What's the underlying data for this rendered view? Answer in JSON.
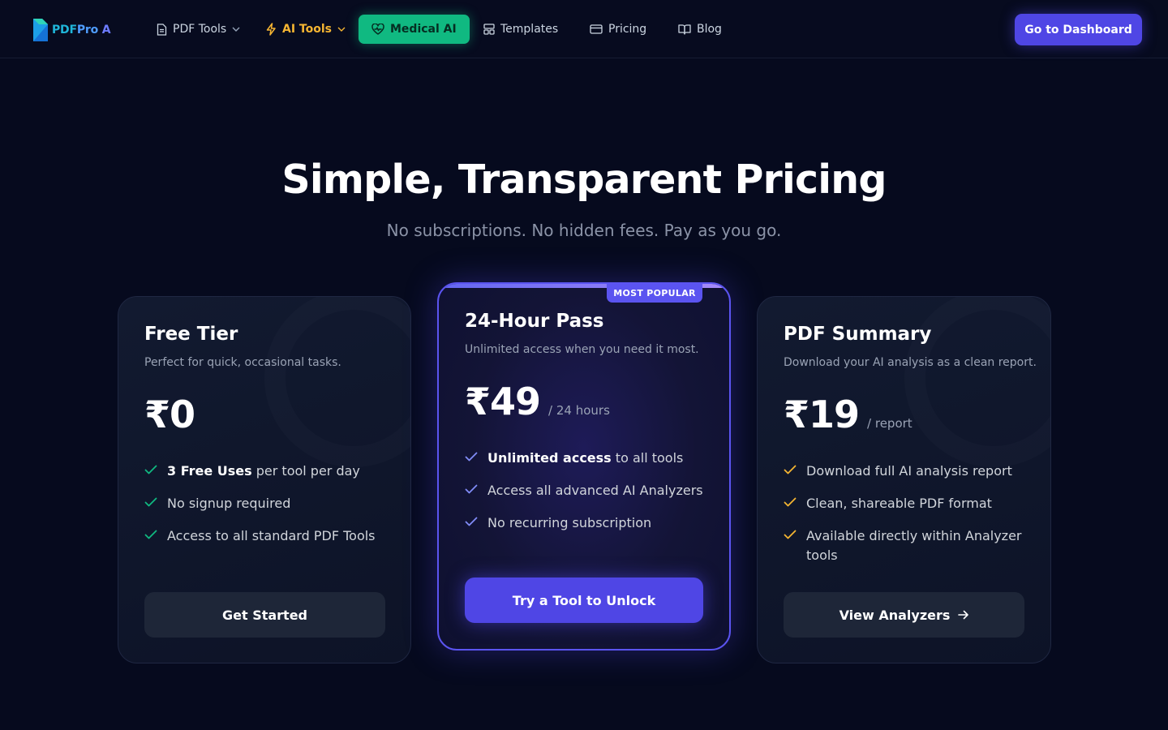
{
  "nav": {
    "logo": {
      "part1": "PDF",
      "part2": "Pro",
      "part3": " A"
    },
    "items": [
      {
        "label": "PDF Tools"
      },
      {
        "label": "AI Tools"
      },
      {
        "label": "Medical AI"
      },
      {
        "label": "Templates"
      },
      {
        "label": "Pricing"
      },
      {
        "label": "Blog"
      }
    ],
    "cta": "Go to Dashboard"
  },
  "hero": {
    "title": "Simple, Transparent Pricing",
    "subtitle": "No subscriptions. No hidden fees. Pay as you go."
  },
  "plans": {
    "free": {
      "title": "Free Tier",
      "description": "Perfect for quick, occasional tasks.",
      "price": "₹0",
      "features": [
        {
          "bold": "3 Free Uses",
          "text": " per tool per day"
        },
        {
          "bold": "",
          "text": "No signup required"
        },
        {
          "bold": "",
          "text": "Access to all standard PDF Tools"
        }
      ],
      "button": "Get Started"
    },
    "pass": {
      "badge": "MOST POPULAR",
      "title": "24-Hour Pass",
      "description": "Unlimited access when you need it most.",
      "price": "₹49",
      "unit": "/ 24 hours",
      "features": [
        {
          "bold": "Unlimited access",
          "text": " to all tools"
        },
        {
          "bold": "",
          "text": "Access all advanced AI Analyzers"
        },
        {
          "bold": "",
          "text": "No recurring subscription"
        }
      ],
      "button": "Try a Tool to Unlock"
    },
    "summary": {
      "title": "PDF Summary",
      "description": "Download your AI analysis as a clean report.",
      "price": "₹19",
      "unit": "/ report",
      "features": [
        {
          "text": "Download full AI analysis report"
        },
        {
          "text": "Clean, shareable PDF format"
        },
        {
          "text": "Available directly within Analyzer tools"
        }
      ],
      "button": "View Analyzers"
    }
  },
  "colors": {
    "accent": "#4f46e5",
    "medical": "#10b981",
    "ai_tools": "#f5b532",
    "check_free": "#10b981",
    "check_pass": "#818cf8",
    "check_summary": "#f5b532"
  },
  "icons": [
    "logo-icon",
    "document-icon",
    "chevron-down-icon",
    "lightning-icon",
    "heart-pulse-icon",
    "layout-icon",
    "credit-card-icon",
    "book-open-icon",
    "check-icon",
    "arrow-right-icon"
  ]
}
